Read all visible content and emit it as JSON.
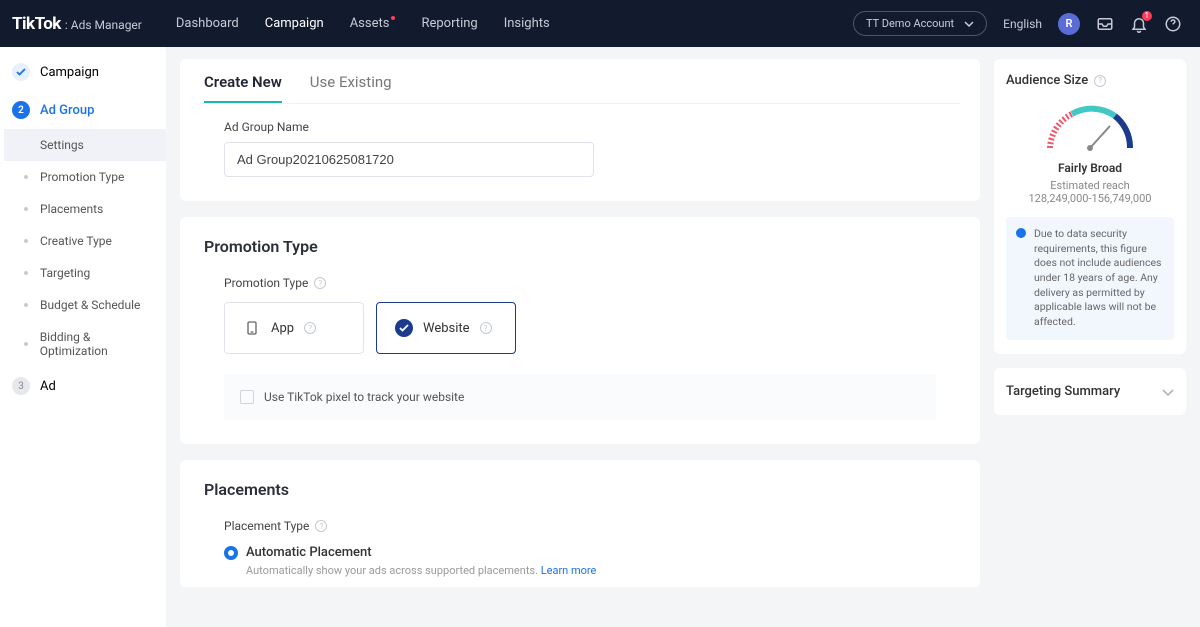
{
  "header": {
    "logo_main": "TikTok",
    "logo_sub": ": Ads Manager",
    "nav": [
      "Dashboard",
      "Campaign",
      "Assets",
      "Reporting",
      "Insights"
    ],
    "account": "TT Demo Account",
    "language": "English",
    "avatar_initial": "R",
    "notification_count": "1"
  },
  "sidebar": {
    "steps": [
      {
        "num": "✓",
        "label": "Campaign"
      },
      {
        "num": "2",
        "label": "Ad Group"
      },
      {
        "num": "3",
        "label": "Ad"
      }
    ],
    "subitems": [
      "Settings",
      "Promotion Type",
      "Placements",
      "Creative Type",
      "Targeting",
      "Budget & Schedule",
      "Bidding & Optimization"
    ]
  },
  "tabs": {
    "create": "Create New",
    "existing": "Use Existing"
  },
  "adgroup": {
    "name_label": "Ad Group Name",
    "name_value": "Ad Group20210625081720"
  },
  "promotion": {
    "title": "Promotion Type",
    "label": "Promotion Type",
    "opt_app": "App",
    "opt_website": "Website",
    "pixel_checkbox": "Use TikTok pixel to track your website"
  },
  "placements": {
    "title": "Placements",
    "label": "Placement Type",
    "auto_label": "Automatic Placement",
    "auto_desc": "Automatically show your ads across supported placements. ",
    "learn_more": "Learn more"
  },
  "audience": {
    "title": "Audience Size",
    "status": "Fairly Broad",
    "sub": "Estimated reach",
    "range": "128,249,000-156,749,000",
    "notice": "Due to data security requirements, this figure does not include audiences under 18 years of age. Any delivery as permitted by applicable laws will not be affected."
  },
  "targeting_summary": "Targeting Summary"
}
